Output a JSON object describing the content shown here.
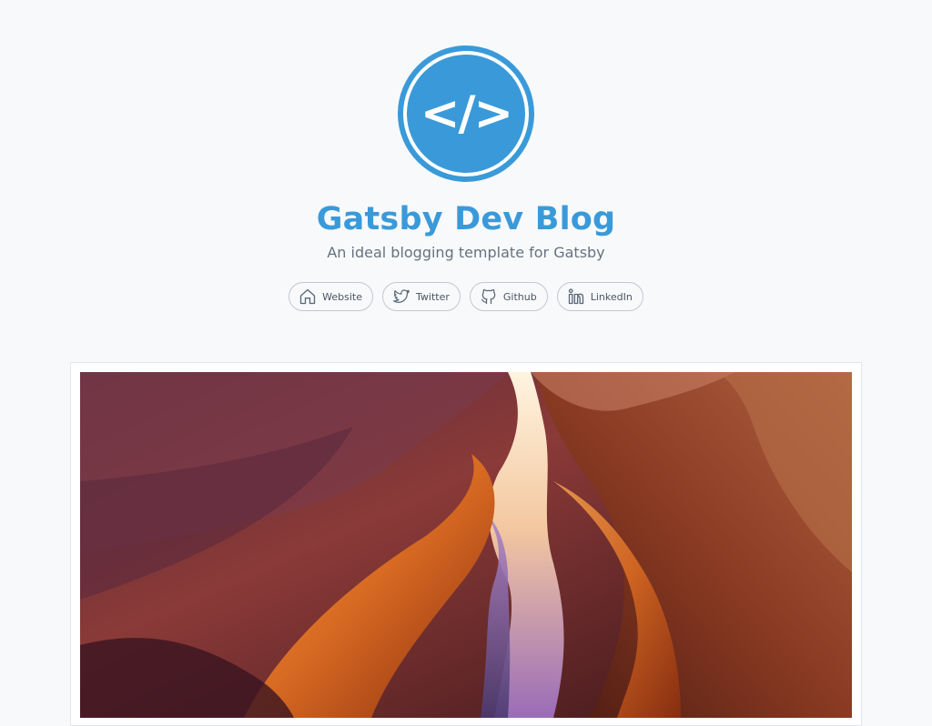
{
  "header": {
    "logo": {
      "glyph": "</>",
      "color": "#3a9ad9",
      "icon": "code-icon"
    },
    "title": "Gatsby Dev Blog",
    "subtitle": "An ideal blogging template for Gatsby"
  },
  "social_links": [
    {
      "label": "Website",
      "icon": "home-icon"
    },
    {
      "label": "Twitter",
      "icon": "twitter-icon"
    },
    {
      "label": "Github",
      "icon": "github-icon"
    },
    {
      "label": "LinkedIn",
      "icon": "linkedin-icon"
    }
  ],
  "featured_post": {
    "image": "canyon-photo"
  },
  "colors": {
    "accent": "#3a9ad9",
    "background": "#f7f9fb",
    "subtitle": "#67727e",
    "button_border": "#c3c8ce"
  }
}
